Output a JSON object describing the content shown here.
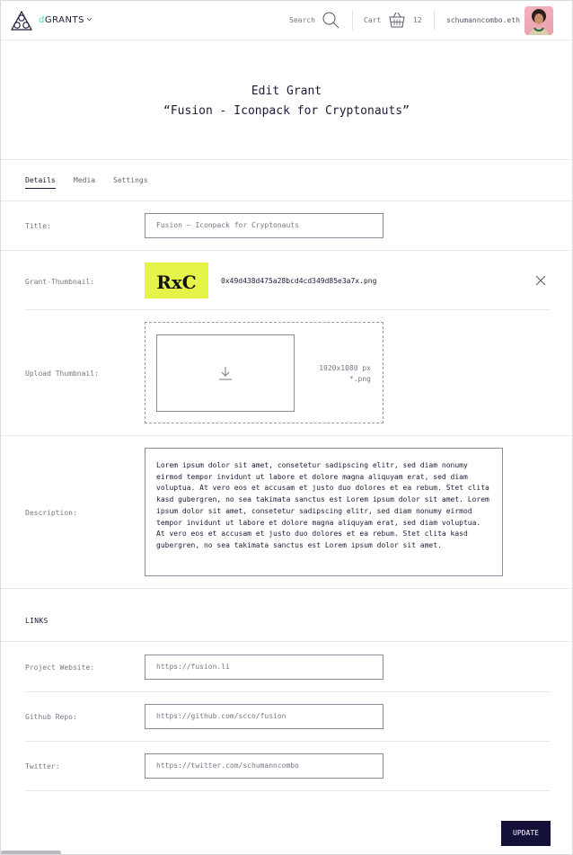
{
  "header": {
    "brand_prefix": "d",
    "brand_rest": "GRANTS",
    "search_label": "Search",
    "cart_label": "Cart",
    "cart_count": "12",
    "user_name": "schumanncombo.eth"
  },
  "page": {
    "title": "Edit Grant",
    "grant_name": "“Fusion - Iconpack for Cryptonauts”"
  },
  "tabs": [
    {
      "label": "Details",
      "active": true
    },
    {
      "label": "Media",
      "active": false
    },
    {
      "label": "Settings",
      "active": false
    }
  ],
  "form": {
    "title_label": "Title:",
    "title_value": "Fusion – Iconpack for Cryptonauts",
    "thumbnail_label": "Grant-Thumbnail:",
    "thumbnail_logo_text": "RxC",
    "thumbnail_file": "0x49d438d475a28bcd4cd349d85e3a7x.png",
    "upload_label": "Upload Thumbnail:",
    "upload_dims": "1920x1080 px",
    "upload_ext": "*.png",
    "description_label": "Description:",
    "description_value": "Lorem ipsum dolor sit amet, consetetur sadipscing elitr, sed diam nonumy eirmod tempor invidunt ut labore et dolore magna aliquyam erat, sed diam voluptua. At vero eos et accusam et justo duo dolores et ea rebum. Stet clita kasd gubergren, no sea takimata sanctus est Lorem ipsum dolor sit amet. Lorem ipsum dolor sit amet, consetetur sadipscing elitr, sed diam nonumy eirmod tempor invidunt ut labore et dolore magna aliquyam erat, sed diam voluptua. At vero eos et accusam et justo duo dolores et ea rebum. Stet clita kasd gubergren, no sea takimata sanctus est Lorem ipsum dolor sit amet."
  },
  "links": {
    "section_title": "LINKS",
    "website_label": "Project Website:",
    "website_value": "https://fusion.li",
    "github_label": "Github Repo:",
    "github_value": "https://github.com/scco/fusion",
    "twitter_label": "Twitter:",
    "twitter_value": "https://twitter.com/schumanncombo"
  },
  "actions": {
    "update_label": "UPDATE"
  },
  "colors": {
    "accent": "#43d9b8",
    "primary": "#13103a",
    "thumbnail_bg": "#e6f44a"
  },
  "icons": [
    "logo-icon",
    "chevron-down-icon",
    "search-icon",
    "cart-icon",
    "close-icon",
    "download-icon"
  ]
}
